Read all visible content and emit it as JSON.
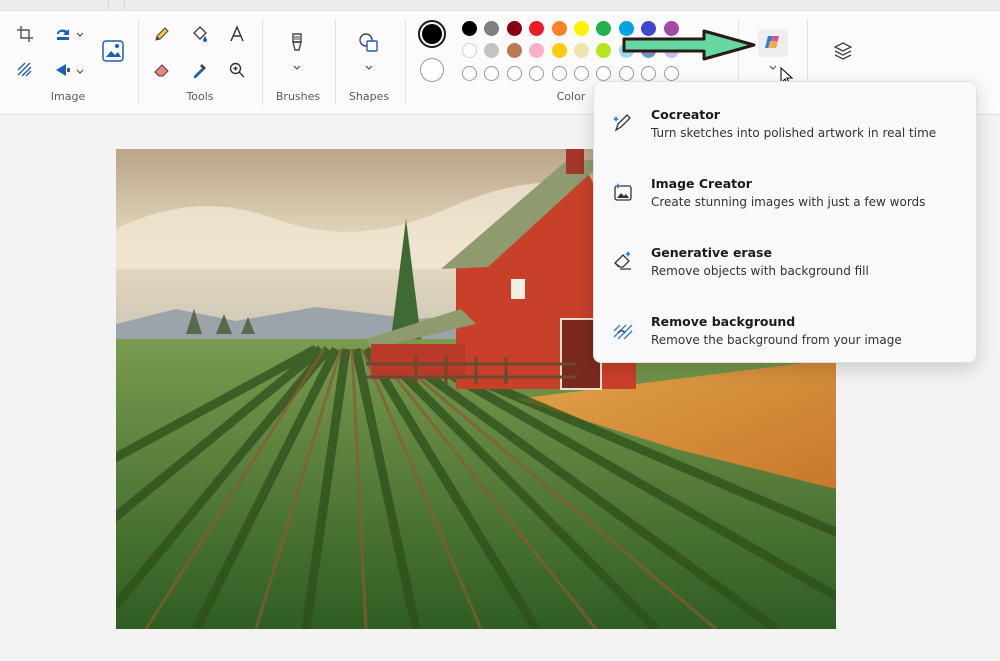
{
  "ribbon": {
    "groups": {
      "image": "Image",
      "tools": "Tools",
      "brushes": "Brushes",
      "shapes": "Shapes",
      "color": "Color"
    }
  },
  "colors": {
    "current_primary": "#000000",
    "current_secondary": "#ffffff",
    "row1": [
      "#000000",
      "#7f7f7f",
      "#880015",
      "#ed1c24",
      "#ff7f27",
      "#fff200",
      "#22b14c",
      "#00a2e8",
      "#3f48cc",
      "#a349a4"
    ],
    "row2": [
      "#ffffff",
      "#c3c3c3",
      "#b97a57",
      "#ffaec9",
      "#ffc90e",
      "#efe4b0",
      "#b5e61d",
      "#99d9ea",
      "#7092be",
      "#c8bfe7"
    ],
    "annotation_arrow": "#66d9a3"
  },
  "cocreate_menu": {
    "items": [
      {
        "title": "Cocreator",
        "description": "Turn sketches into polished artwork in real time",
        "icon": "pen-sparkle-icon"
      },
      {
        "title": "Image Creator",
        "description": "Create stunning images with just a few words",
        "icon": "image-sparkle-icon"
      },
      {
        "title": "Generative erase",
        "description": "Remove objects with background fill",
        "icon": "eraser-sparkle-icon"
      },
      {
        "title": "Remove background",
        "description": "Remove the background from your image",
        "icon": "remove-background-icon"
      }
    ]
  },
  "canvas": {
    "description_icon": "farm-painting"
  }
}
